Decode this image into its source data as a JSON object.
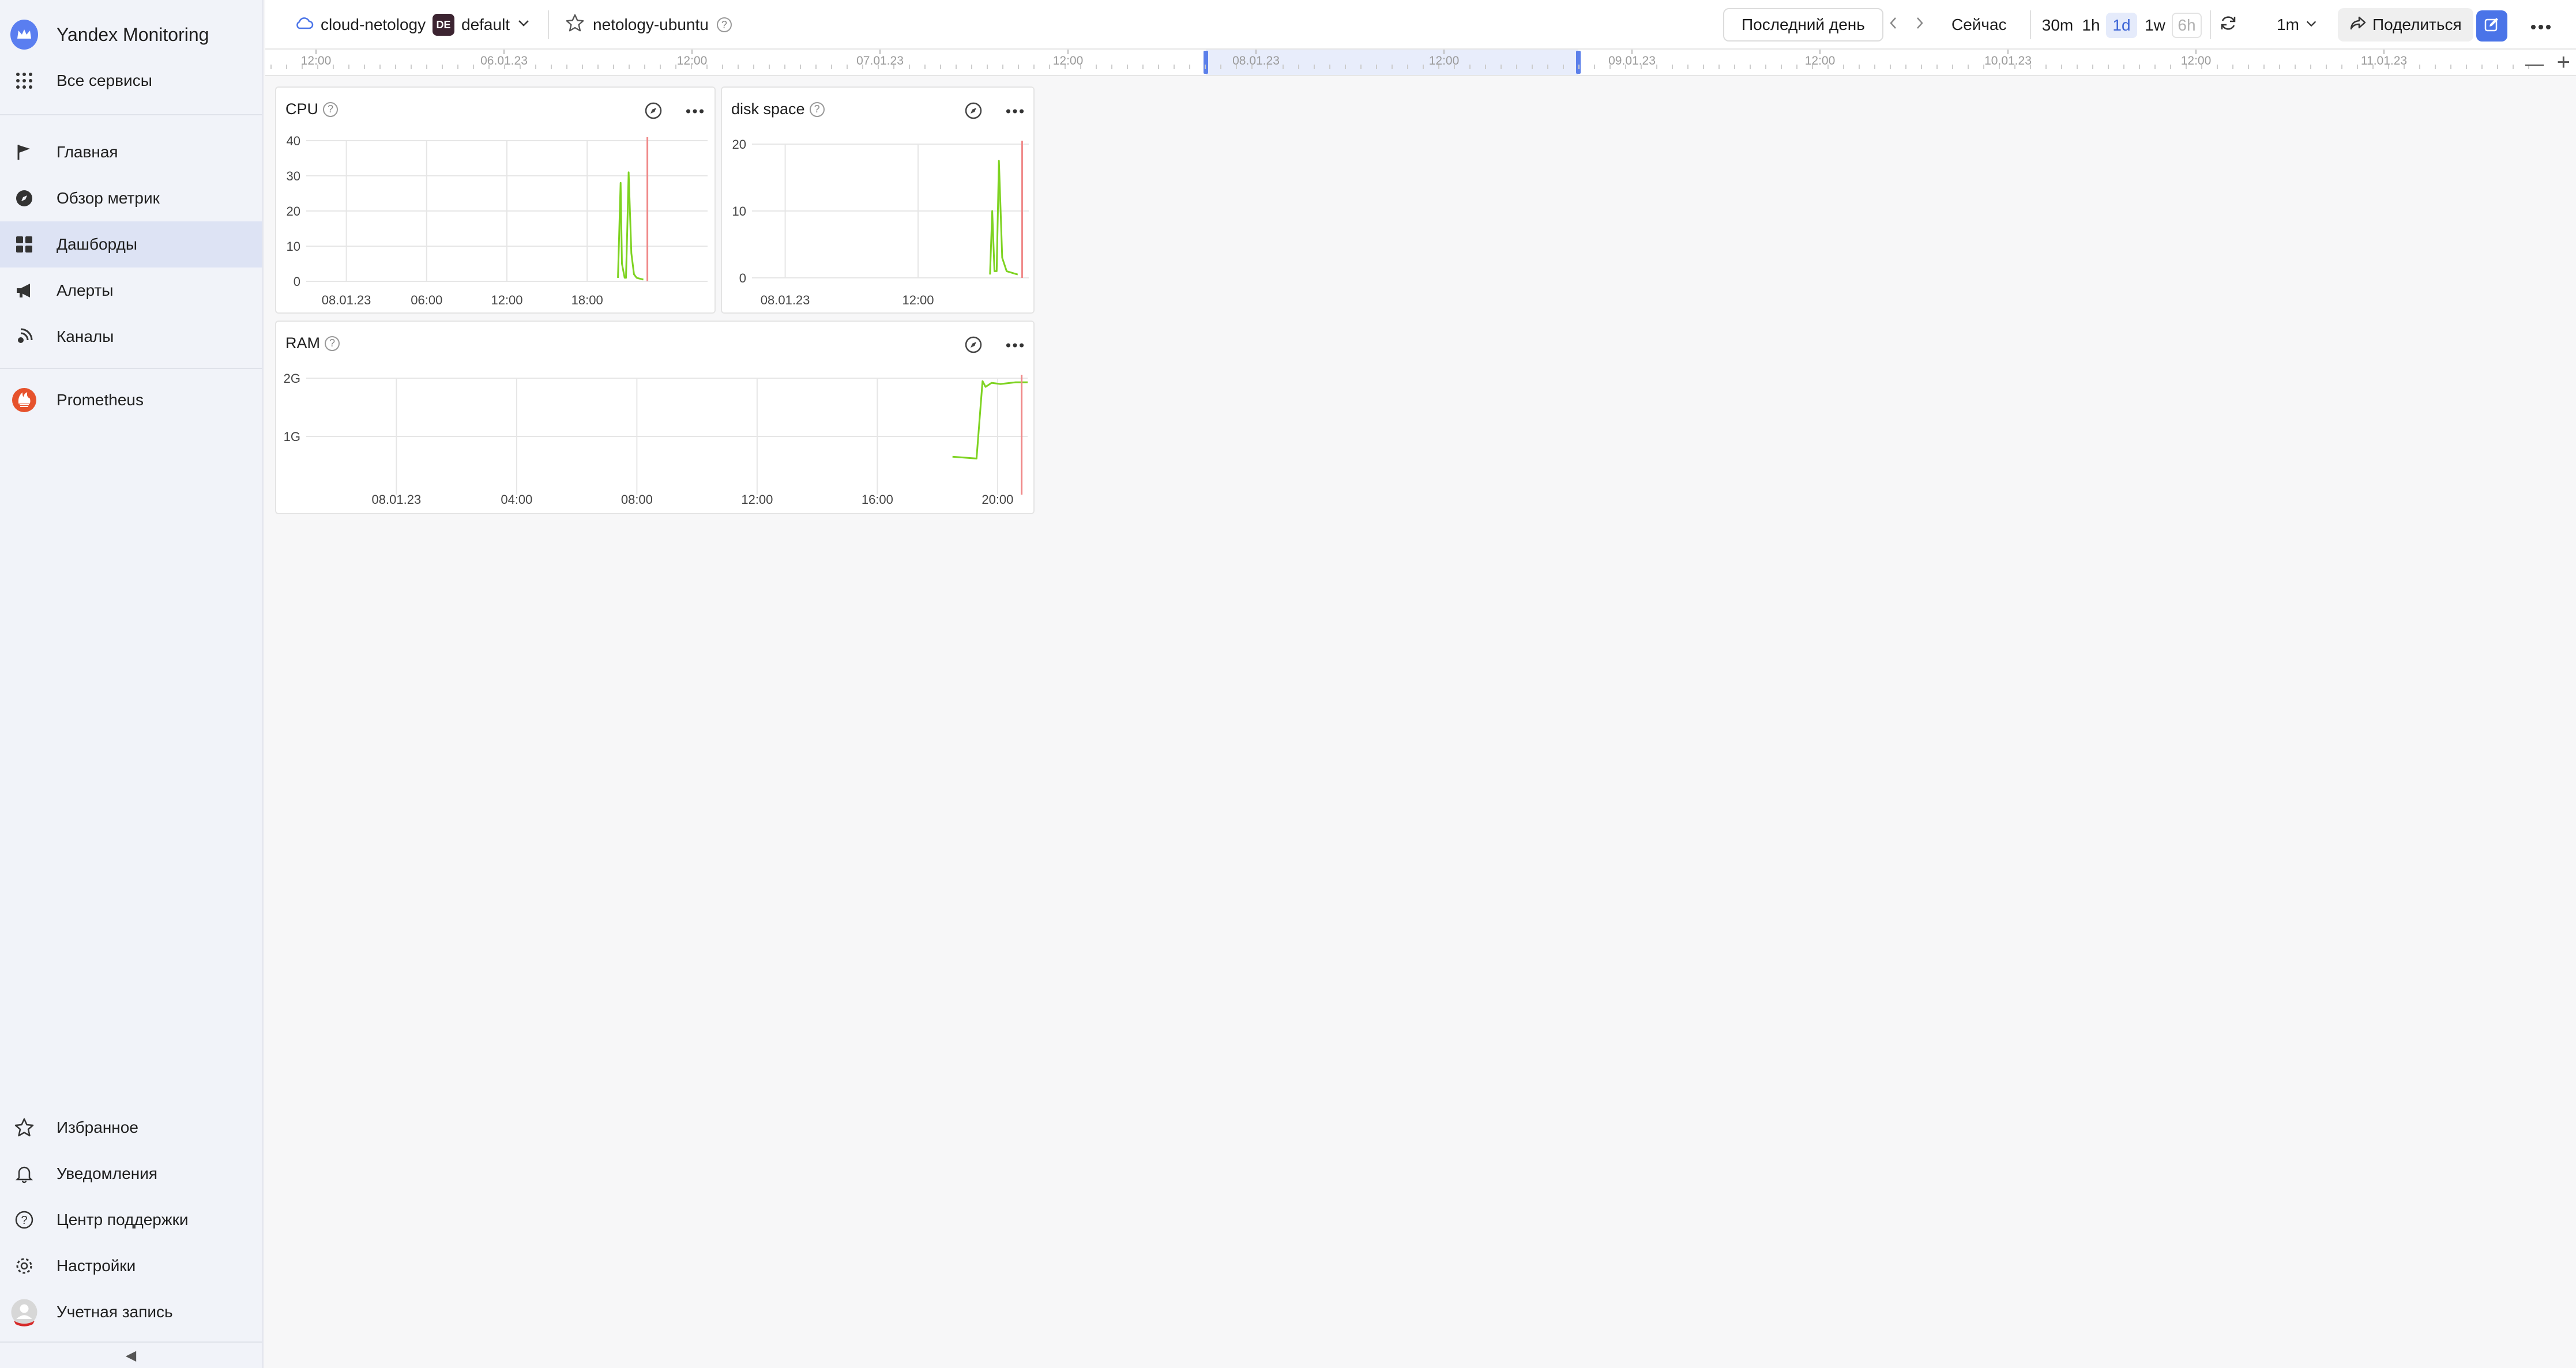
{
  "sidebar": {
    "brand": "Yandex Monitoring",
    "all_services": "Все сервисы",
    "nav": [
      {
        "label": "Главная",
        "icon": "flag-icon"
      },
      {
        "label": "Обзор метрик",
        "icon": "compass-icon"
      },
      {
        "label": "Дашборды",
        "icon": "dashboard-icon",
        "active": true
      },
      {
        "label": "Алерты",
        "icon": "megaphone-icon"
      },
      {
        "label": "Каналы",
        "icon": "broadcast-icon"
      }
    ],
    "prometheus": "Prometheus",
    "bottom": [
      {
        "label": "Избранное",
        "icon": "star-icon"
      },
      {
        "label": "Уведомления",
        "icon": "bell-icon"
      },
      {
        "label": "Центр поддержки",
        "icon": "help-icon"
      },
      {
        "label": "Настройки",
        "icon": "gear-icon"
      },
      {
        "label": "Учетная запись",
        "icon": "avatar-icon"
      }
    ],
    "collapse": "◀"
  },
  "topbar": {
    "cloud": "cloud-netology",
    "folder_badge": "DE",
    "folder": "default",
    "dashboard": "netology-ubuntu",
    "period": "Последний день",
    "now": "Сейчас",
    "ranges": [
      "30m",
      "1h",
      "1d",
      "1w",
      "6h"
    ],
    "selected_range": "1d",
    "disabled_range": "6h",
    "refresh": "1m",
    "share": "Поделиться"
  },
  "timeline": {
    "labels": [
      "12:00",
      "06.01.23",
      "12:00",
      "07.01.23",
      "12:00",
      "08.01.23",
      "12:00",
      "09.01.23",
      "12:00",
      "10.01.23",
      "12:00",
      "11.01.23"
    ]
  },
  "panels": {
    "cpu": {
      "title": "CPU"
    },
    "disk": {
      "title": "disk space"
    },
    "ram": {
      "title": "RAM"
    }
  },
  "chart_data": [
    {
      "id": "cpu",
      "type": "line",
      "title": "CPU",
      "yticks": [
        0,
        10,
        20,
        30,
        40
      ],
      "ylim": [
        0,
        40
      ],
      "xticks": [
        "08.01.23",
        "06:00",
        "12:00",
        "18:00"
      ],
      "xlim_hours": [
        -3,
        27
      ],
      "series": [
        {
          "color": "#7ed321",
          "x": [
            20.3,
            20.5,
            20.6,
            20.8,
            20.9,
            21.0,
            21.1,
            21.3,
            21.5,
            21.7,
            22.2
          ],
          "y": [
            1,
            28,
            5,
            1,
            1,
            15,
            31,
            8,
            2,
            1,
            0.5
          ]
        }
      ],
      "marker_x": 22.5
    },
    {
      "id": "disk",
      "type": "line",
      "title": "disk space",
      "yticks": [
        0,
        10,
        20
      ],
      "ylim": [
        0,
        20
      ],
      "xticks": [
        "08.01.23",
        "12:00"
      ],
      "xlim_hours": [
        -3,
        22
      ],
      "series": [
        {
          "color": "#7ed321",
          "x": [
            18.5,
            18.7,
            18.9,
            19.1,
            19.3,
            19.6,
            20.0,
            21.0
          ],
          "y": [
            0.5,
            10,
            1,
            1,
            17.5,
            3,
            1,
            0.5
          ]
        }
      ],
      "marker_x": 21.4
    },
    {
      "id": "ram",
      "type": "line",
      "title": "RAM",
      "yticks": [
        "1G",
        "2G"
      ],
      "ylim_gb": [
        0,
        2
      ],
      "xticks": [
        "08.01.23",
        "04:00",
        "08:00",
        "12:00",
        "16:00",
        "20:00"
      ],
      "xlim_hours": [
        -3,
        21
      ],
      "series": [
        {
          "color": "#7ed321",
          "x": [
            18.5,
            19.3,
            19.5,
            19.6,
            19.8,
            20.1,
            20.6,
            21.0
          ],
          "y": [
            0.65,
            0.62,
            1.95,
            1.85,
            1.92,
            1.9,
            1.93,
            1.93
          ]
        }
      ],
      "marker_x": 20.8
    }
  ]
}
